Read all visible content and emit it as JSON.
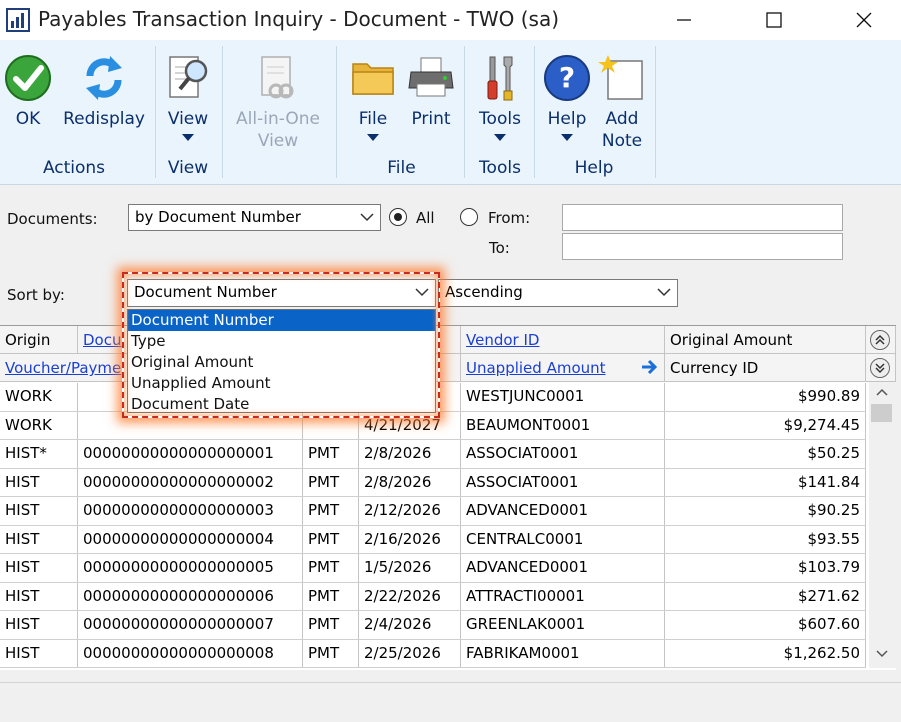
{
  "window": {
    "title": "Payables Transaction Inquiry - Document  -  TWO (sa)"
  },
  "ribbon": {
    "ok": "OK",
    "redisplay": "Redisplay",
    "actions_group": "Actions",
    "view": "View",
    "view_group": "View",
    "all_in_one_1": "All-in-One",
    "all_in_one_2": "View",
    "file": "File",
    "print": "Print",
    "file_group": "File",
    "tools": "Tools",
    "tools_group": "Tools",
    "help": "Help",
    "add_note_1": "Add",
    "add_note_2": "Note",
    "help_group": "Help"
  },
  "filters": {
    "documents_label": "Documents:",
    "documents_value": "by Document Number",
    "all_label": "All",
    "from_label": "From:",
    "to_label": "To:",
    "sort_label": "Sort by:",
    "sort_value": "Document Number",
    "order_value": "Ascending"
  },
  "sort_options": [
    "Document Number",
    "Type",
    "Original Amount",
    "Unapplied Amount",
    "Document Date"
  ],
  "grid": {
    "headers_row1": {
      "origin": "Origin",
      "document": "Docu",
      "vendor": "Vendor ID",
      "original_amount": "Original Amount"
    },
    "headers_row2": {
      "voucher": "Voucher/Payme",
      "unapplied": "Unapplied Amount",
      "currency": "Currency ID"
    },
    "rows": [
      {
        "origin": "WORK",
        "doc": "",
        "type": "",
        "date": "",
        "vendor": "WESTJUNC0001",
        "amount": "$990.89"
      },
      {
        "origin": "WORK",
        "doc": "",
        "type": "",
        "date": "4/21/2027",
        "vendor": "BEAUMONT0001",
        "amount": "$9,274.45"
      },
      {
        "origin": "HIST*",
        "doc": "00000000000000000001",
        "type": "PMT",
        "date": "2/8/2026",
        "vendor": "ASSOCIAT0001",
        "amount": "$50.25"
      },
      {
        "origin": "HIST",
        "doc": "00000000000000000002",
        "type": "PMT",
        "date": "2/8/2026",
        "vendor": "ASSOCIAT0001",
        "amount": "$141.84"
      },
      {
        "origin": "HIST",
        "doc": "00000000000000000003",
        "type": "PMT",
        "date": "2/12/2026",
        "vendor": "ADVANCED0001",
        "amount": "$90.25"
      },
      {
        "origin": "HIST",
        "doc": "00000000000000000004",
        "type": "PMT",
        "date": "2/16/2026",
        "vendor": "CENTRALC0001",
        "amount": "$93.55"
      },
      {
        "origin": "HIST",
        "doc": "00000000000000000005",
        "type": "PMT",
        "date": "1/5/2026",
        "vendor": "ADVANCED0001",
        "amount": "$103.79"
      },
      {
        "origin": "HIST",
        "doc": "00000000000000000006",
        "type": "PMT",
        "date": "2/22/2026",
        "vendor": "ATTRACTI00001",
        "amount": "$271.62"
      },
      {
        "origin": "HIST",
        "doc": "00000000000000000007",
        "type": "PMT",
        "date": "2/4/2026",
        "vendor": "GREENLAK0001",
        "amount": "$607.60"
      },
      {
        "origin": "HIST",
        "doc": "00000000000000000008",
        "type": "PMT",
        "date": "2/25/2026",
        "vendor": "FABRIKAM0001",
        "amount": "$1,262.50"
      }
    ]
  },
  "colors": {
    "accent": "#0a64c8",
    "link": "#1a3fd4",
    "highlight": "#c72a1f"
  }
}
